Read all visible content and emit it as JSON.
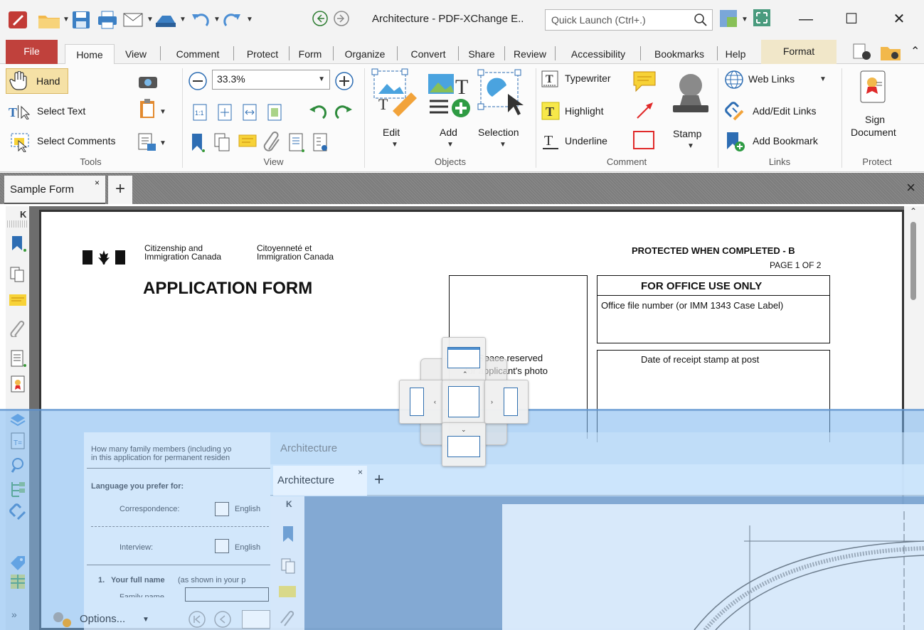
{
  "window": {
    "title": "Architecture - PDF-XChange E..",
    "quick_launch_placeholder": "Quick Launch (Ctrl+.)",
    "minimize": "—",
    "maximize": "☐",
    "close": "✕"
  },
  "ribbon_tabs": [
    "File",
    "Home",
    "View",
    "Comment",
    "Protect",
    "Form",
    "Organize",
    "Convert",
    "Share",
    "Review",
    "Accessibility",
    "Bookmarks",
    "Help",
    "Format"
  ],
  "active_tab": "Home",
  "ribbon": {
    "tools": {
      "label": "Tools",
      "hand": "Hand",
      "select_text": "Select Text",
      "select_comments": "Select Comments"
    },
    "view": {
      "label": "View",
      "zoom": "33.3%"
    },
    "objects": {
      "label": "Objects",
      "edit": "Edit",
      "add": "Add",
      "selection": "Selection"
    },
    "comment": {
      "label": "Comment",
      "typewriter": "Typewriter",
      "highlight": "Highlight",
      "underline": "Underline",
      "stamp": "Stamp"
    },
    "links": {
      "label": "Links",
      "web_links": "Web Links",
      "add_edit_links": "Add/Edit Links",
      "add_bookmark": "Add Bookmark"
    },
    "protect": {
      "label": "Protect",
      "sign_document": "Sign Document"
    }
  },
  "doc_tab": {
    "name": "Sample Form",
    "close": "×",
    "add": "+",
    "close_doc": "×"
  },
  "document": {
    "dept_en_1": "Citizenship and",
    "dept_en_2": "Immigration Canada",
    "dept_fr_1": "Citoyenneté et",
    "dept_fr_2": "Immigration Canada",
    "protected": "PROTECTED WHEN COMPLETED - B",
    "page_of": "PAGE 1 OF 2",
    "form_title": "APPLICATION FORM",
    "office_use": "FOR OFFICE USE ONLY",
    "office_file": "Office file number (or IMM 1343 Case Label)",
    "photo_1": "Space reserved",
    "photo_2": "for applicant's photo",
    "receipt": "Date of receipt stamp at post"
  },
  "form_behind": {
    "family_1": "How many family members (including yo",
    "family_2": "in this application for permanent residen",
    "language": "Language you prefer for:",
    "correspondence": "Correspondence:",
    "english": "English",
    "interview": "Interview:",
    "english2": "English",
    "q1_num": "1.",
    "q1_bold": "Your full name",
    "q1_rest": "(as shown in your p",
    "family_name": "Family name"
  },
  "floating_window": {
    "title": "Architecture",
    "tab": "Architecture",
    "close": "×",
    "add": "+"
  },
  "status": {
    "options": "Options...",
    "chev": "»"
  }
}
